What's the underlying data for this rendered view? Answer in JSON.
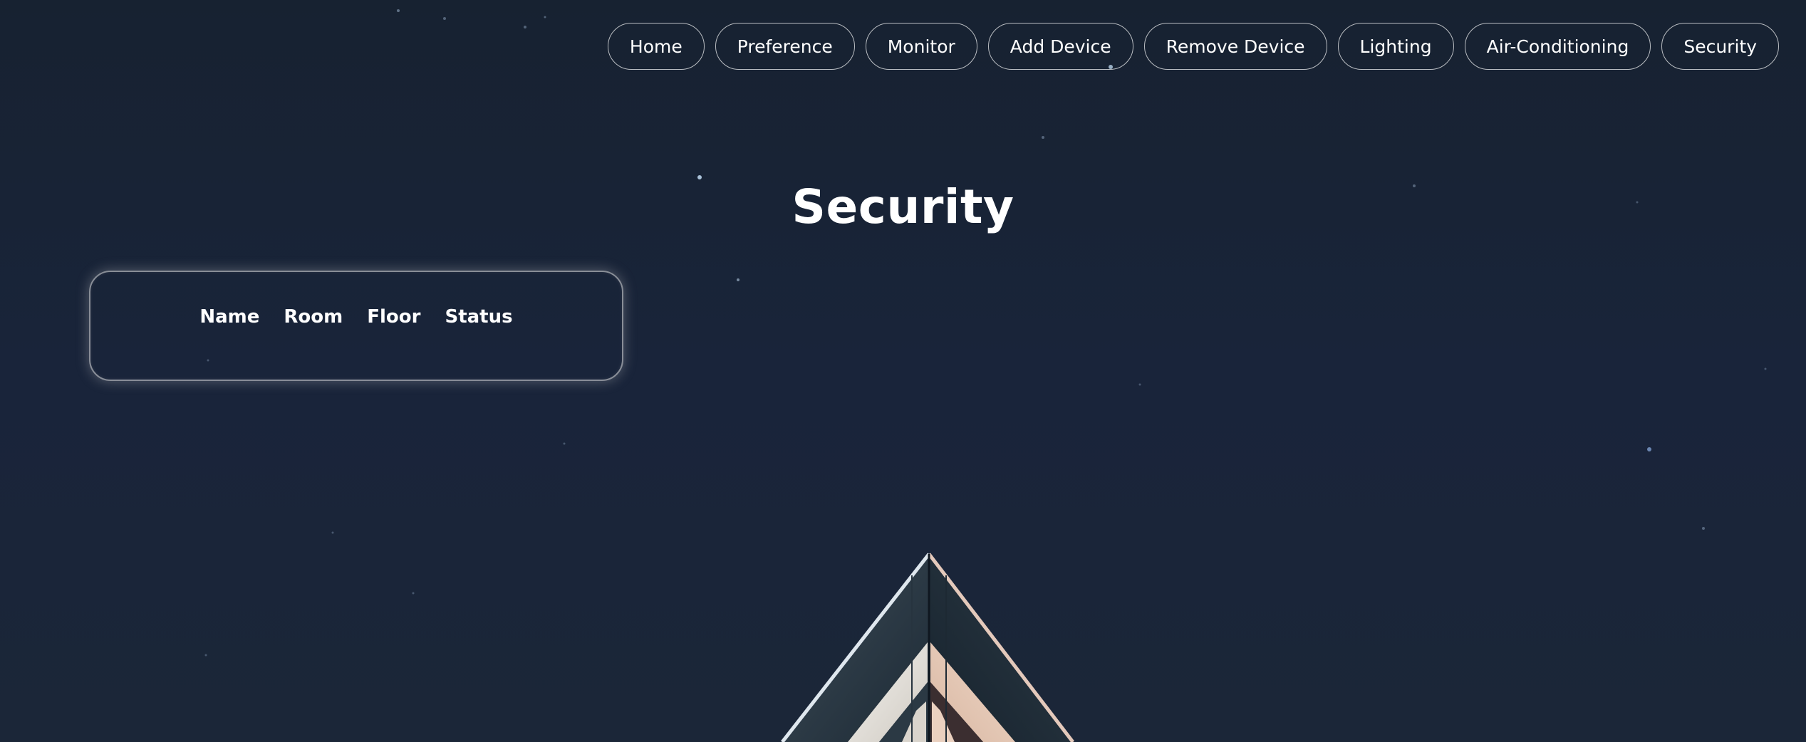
{
  "nav": {
    "items": [
      {
        "label": "Home"
      },
      {
        "label": "Preference"
      },
      {
        "label": "Monitor"
      },
      {
        "label": "Add Device"
      },
      {
        "label": "Remove Device"
      },
      {
        "label": "Lighting"
      },
      {
        "label": "Air-Conditioning"
      },
      {
        "label": "Security"
      }
    ]
  },
  "page": {
    "title": "Security"
  },
  "security_table": {
    "columns": [
      "Name",
      "Room",
      "Floor",
      "Status"
    ],
    "rows": []
  },
  "theme": {
    "background": "#172231",
    "text": "#ffffff",
    "border": "#cfd3d8"
  }
}
